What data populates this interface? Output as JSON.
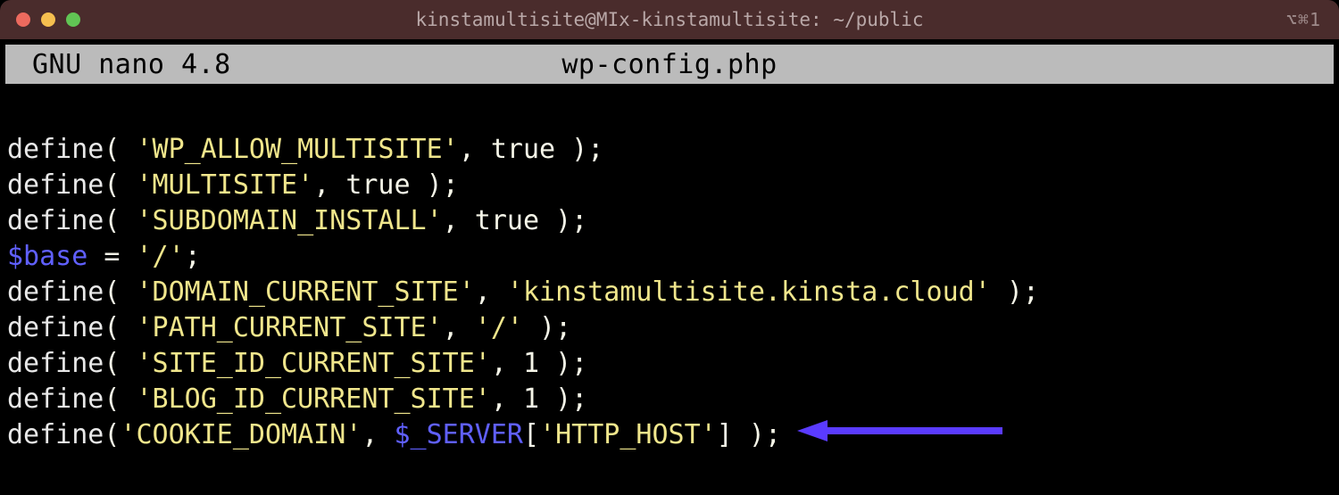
{
  "titlebar": {
    "title": "kinstamultisite@MIx-kinstamultisite: ~/public",
    "shortcut": "⌥⌘1"
  },
  "nano": {
    "app": "GNU nano 4.8",
    "filename": "wp-config.php"
  },
  "code": {
    "lines": [
      {
        "type": "define_bool",
        "key": "'WP_ALLOW_MULTISITE'",
        "val": "true"
      },
      {
        "type": "define_bool",
        "key": "'MULTISITE'",
        "val": "true"
      },
      {
        "type": "define_bool",
        "key": "'SUBDOMAIN_INSTALL'",
        "val": "true"
      },
      {
        "type": "assign",
        "var": "$base",
        "val": "'/'"
      },
      {
        "type": "define_str",
        "key": "'DOMAIN_CURRENT_SITE'",
        "val": "'kinstamultisite.kinsta.cloud'"
      },
      {
        "type": "define_str",
        "key": "'PATH_CURRENT_SITE'",
        "val": "'/'"
      },
      {
        "type": "define_num",
        "key": "'SITE_ID_CURRENT_SITE'",
        "val": "1"
      },
      {
        "type": "define_num",
        "key": "'BLOG_ID_CURRENT_SITE'",
        "val": "1"
      },
      {
        "type": "define_expr",
        "key": "'COOKIE_DOMAIN'",
        "expr_var": "$_SERVER",
        "expr_key": "'HTTP_HOST'",
        "arrow": true
      }
    ]
  },
  "tokens": {
    "define": "define",
    "open_p": "(",
    "close_p": ")",
    "open_sp": "( ",
    "close_sp": " )",
    "comma_sp": ", ",
    "semi": ";",
    "eq": " = ",
    "bracket_open": "[",
    "bracket_close": "]"
  },
  "arrow_color": "#5a3bff"
}
